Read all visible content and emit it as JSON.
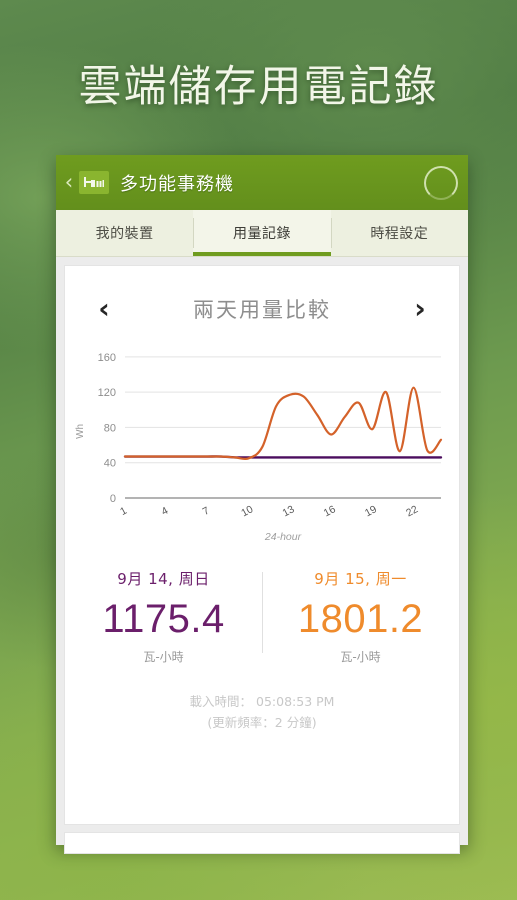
{
  "page": {
    "headline": "雲端儲存用電記錄"
  },
  "app_header": {
    "back_icon": "‹",
    "logo_name": "bn-logo",
    "title": "多功能事務機",
    "refresh_icon": "loading-ring"
  },
  "tabs": [
    {
      "label": "我的裝置",
      "active": false
    },
    {
      "label": "用量記錄",
      "active": true
    },
    {
      "label": "時程設定",
      "active": false
    }
  ],
  "chart_nav": {
    "prev_icon": "‹",
    "next_icon": "›",
    "title": "兩天用量比較"
  },
  "totals": [
    {
      "date": "9月 14, 周日",
      "value": "1175.4",
      "unit": "瓦-小時",
      "color": "#6b1f6b"
    },
    {
      "date": "9月 15, 周一",
      "value": "1801.2",
      "unit": "瓦-小時",
      "color": "#ef8b2c"
    }
  ],
  "footer": {
    "load_time": "載入時間： 05:08:53 PM",
    "refresh_rate": "(更新頻率：2 分鐘)"
  },
  "colors": {
    "header_green": "#6f9c1f",
    "tab_bg": "#edf0e0",
    "series_orange": "#d4622a",
    "series_purple": "#4b0d5e",
    "grid": "#e3e3e3"
  },
  "chart_data": {
    "type": "line",
    "title": "兩天用量比較",
    "xlabel": "24-hour",
    "ylabel": "Wh",
    "ylim": [
      0,
      170
    ],
    "yticks": [
      0,
      40,
      80,
      120,
      160
    ],
    "xlim": [
      1,
      24
    ],
    "xticks": [
      1,
      4,
      7,
      10,
      13,
      16,
      19,
      22
    ],
    "grid": true,
    "legend": "none",
    "x": [
      1,
      2,
      3,
      4,
      5,
      6,
      7,
      8,
      9,
      10,
      11,
      12,
      13,
      14,
      15,
      16,
      17,
      18,
      19,
      20,
      21,
      22,
      23,
      24
    ],
    "series": [
      {
        "name": "9月 15, 周一",
        "color": "#d4622a",
        "total": 1801.2,
        "values": [
          47,
          47,
          47,
          47,
          47,
          47,
          47,
          47,
          46,
          45,
          58,
          104,
          117,
          115,
          94,
          72,
          92,
          108,
          78,
          120,
          53,
          125,
          54,
          66
        ]
      },
      {
        "name": "9月 14, 周日",
        "color": "#4b0d5e",
        "total": 1175.4,
        "values": [
          47,
          47,
          47,
          47,
          47,
          47,
          47,
          47,
          46,
          46,
          46,
          46,
          46,
          46,
          46,
          46,
          46,
          46,
          46,
          46,
          46,
          46,
          46,
          46
        ]
      }
    ]
  }
}
